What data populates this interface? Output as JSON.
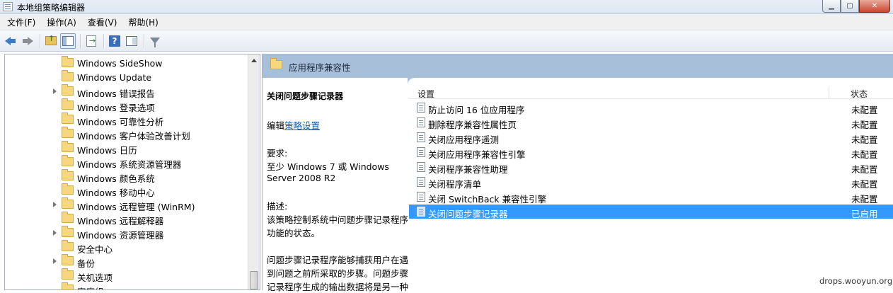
{
  "window": {
    "title": "本地组策略编辑器",
    "controls": [
      "minimize",
      "maximize",
      "close"
    ]
  },
  "menu": {
    "items": [
      "文件(F)",
      "操作(A)",
      "查看(V)",
      "帮助(H)"
    ]
  },
  "toolbar": {
    "buttons": [
      "back-icon",
      "forward-icon",
      "up-folder-icon",
      "show-tree-icon",
      "export-list-icon",
      "help-icon",
      "properties-icon",
      "filter-icon"
    ]
  },
  "tree": {
    "items": [
      {
        "label": "Windows SideShow",
        "expandable": false
      },
      {
        "label": "Windows Update",
        "expandable": false
      },
      {
        "label": "Windows 错误报告",
        "expandable": true
      },
      {
        "label": "Windows 登录选项",
        "expandable": false
      },
      {
        "label": "Windows 可靠性分析",
        "expandable": false
      },
      {
        "label": "Windows 客户体验改善计划",
        "expandable": false
      },
      {
        "label": "Windows 日历",
        "expandable": false
      },
      {
        "label": "Windows 系统资源管理器",
        "expandable": false
      },
      {
        "label": "Windows 颜色系统",
        "expandable": false
      },
      {
        "label": "Windows 移动中心",
        "expandable": false
      },
      {
        "label": "Windows 远程管理 (WinRM)",
        "expandable": true
      },
      {
        "label": "Windows 远程解释器",
        "expandable": false
      },
      {
        "label": "Windows 资源管理器",
        "expandable": true
      },
      {
        "label": "安全中心",
        "expandable": false
      },
      {
        "label": "备份",
        "expandable": true
      },
      {
        "label": "关机选项",
        "expandable": false
      },
      {
        "label": "家庭组",
        "expandable": false
      }
    ]
  },
  "header": {
    "title": "应用程序兼容性"
  },
  "description": {
    "title": "关闭问题步骤记录器",
    "edit_prefix": "编辑",
    "edit_link": "策略设置",
    "requirements_label": "要求:",
    "requirements_line1": "至少 Windows 7 或 Windows",
    "requirements_line2": "Server 2008 R2",
    "desc_label": "描述:",
    "desc_line1": "该策略控制系统中问题步骤记录程序",
    "desc_line2": "功能的状态。",
    "desc_line3": "问题步骤记录程序能够捕获用户在遇",
    "desc_line4": "到问题之前所采取的步骤。问题步骤",
    "desc_line5": "记录程序生成的输出数据将是另一种"
  },
  "list": {
    "columns": {
      "setting": "设置",
      "state": "状态"
    },
    "rows": [
      {
        "name": "防止访问 16 位应用程序",
        "state": "未配置",
        "selected": false
      },
      {
        "name": "删除程序兼容性属性页",
        "state": "未配置",
        "selected": false
      },
      {
        "name": "关闭应用程序遥测",
        "state": "未配置",
        "selected": false
      },
      {
        "name": "关闭应用程序兼容性引擎",
        "state": "未配置",
        "selected": false
      },
      {
        "name": "关闭程序兼容性助理",
        "state": "未配置",
        "selected": false
      },
      {
        "name": "关闭程序清单",
        "state": "未配置",
        "selected": false
      },
      {
        "name": "关闭 SwitchBack 兼容性引擎",
        "state": "未配置",
        "selected": false
      },
      {
        "name": "关闭问题步骤记录器",
        "state": "已启用",
        "selected": true
      }
    ]
  },
  "colors": {
    "selection": "#3399ff",
    "header_band": "#a7bfd9",
    "link": "#0a5cc4"
  },
  "watermark": "drops.wooyun.org"
}
